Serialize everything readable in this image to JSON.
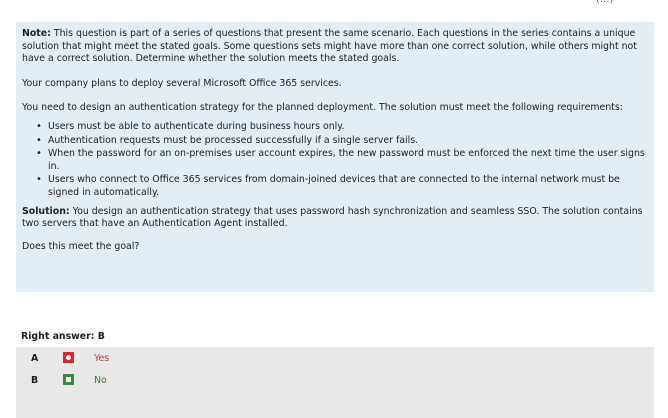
{
  "header_fragment": "(...)",
  "question": {
    "note_label": "Note:",
    "note_text": "This question is part of a series of questions that present the same scenario. Each questions in the series contains a unique solution that might meet the stated goals. Some questions sets might have more than one correct solution, while others might not have a correct solution. Determine whether the solution meets the stated goals.",
    "intro": "Your company plans to deploy several Microsoft Office 365 services.",
    "requirement_intro": "You need to design an authentication strategy for the planned deployment. The solution must meet the following requirements:",
    "requirements": [
      "Users must be able to authenticate during business hours only.",
      "Authentication requests must be processed successfully if a single server fails.",
      "When the password for an on-premises user account expires, the new password must be enforced the next time the user signs in.",
      "Users who connect to Office 365 services from domain-joined devices that are connected to the internal network must be signed in automatically."
    ],
    "solution_label": "Solution:",
    "solution_text": "You design an authentication strategy that uses password hash synchronization and seamless SSO. The solution contains two servers that have an Authentication Agent installed.",
    "prompt": "Does this meet the goal?"
  },
  "answer": {
    "label": "Right answer: B",
    "options": [
      {
        "letter": "A",
        "text": "Yes",
        "status": "incorrect"
      },
      {
        "letter": "B",
        "text": "No",
        "status": "correct"
      }
    ]
  },
  "colors": {
    "question_bg": "#e3edf6",
    "answer_bg": "#e8e8e8",
    "wrong": "#e4222a",
    "right": "#2f9133"
  }
}
